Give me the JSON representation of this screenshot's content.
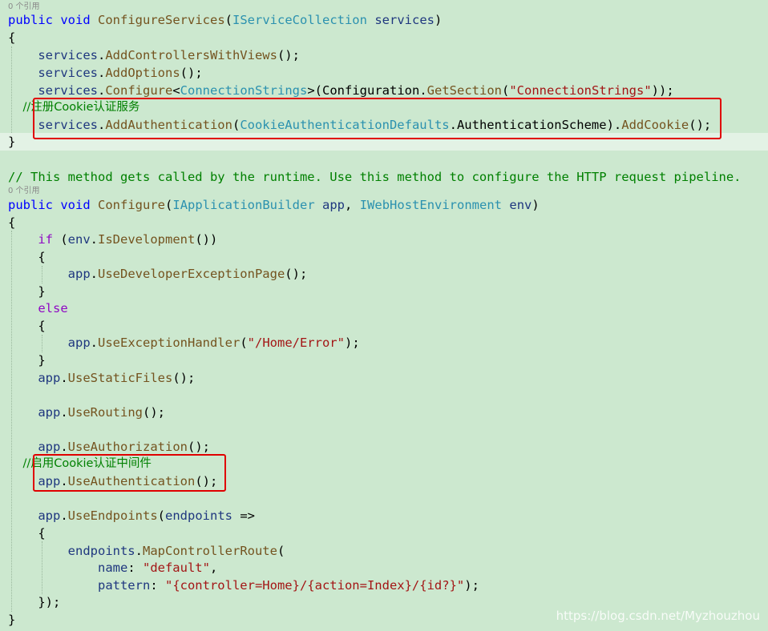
{
  "codelens": {
    "configure_services_refs": "0 个引用",
    "configure_refs": "0 个引用"
  },
  "code": {
    "l1": {
      "kw1": "public",
      "kw2": "void",
      "method": "ConfigureServices",
      "p1": "(",
      "type": "IServiceCollection",
      "param": "services",
      "p2": ")"
    },
    "l2": "{",
    "l3": {
      "obj": "services",
      "dot": ".",
      "method": "AddControllersWithViews",
      "rest": "();"
    },
    "l4": {
      "obj": "services",
      "dot": ".",
      "method": "AddOptions",
      "rest": "();"
    },
    "l5": {
      "obj": "services",
      "dot": ".",
      "method": "Configure",
      "lt": "<",
      "type": "ConnectionStrings",
      "gt": ">",
      "p1": "(",
      "cfg": "Configuration",
      "dot2": ".",
      "method2": "GetSection",
      "p2": "(",
      "str": "\"ConnectionStrings\"",
      "end": "));"
    },
    "l6": "//注册Cookie认证服务",
    "l7": {
      "obj": "services",
      "dot": ".",
      "method": "AddAuthentication",
      "p1": "(",
      "type": "CookieAuthenticationDefaults",
      "dot2": ".",
      "prop": "AuthenticationScheme",
      "p2": ").",
      "method2": "AddCookie",
      "end": "();"
    },
    "l8": "}",
    "l9": "// This method gets called by the runtime. Use this method to configure the HTTP request pipeline.",
    "l10": {
      "kw1": "public",
      "kw2": "void",
      "method": "Configure",
      "p1": "(",
      "type1": "IApplicationBuilder",
      "param1": "app",
      "comma": ",",
      "type2": "IWebHostEnvironment",
      "param2": "env",
      "p2": ")"
    },
    "l11": "{",
    "l12": {
      "kw": "if",
      "p1": " (",
      "obj": "env",
      "dot": ".",
      "method": "IsDevelopment",
      "end": "())"
    },
    "l13": "{",
    "l14": {
      "obj": "app",
      "dot": ".",
      "method": "UseDeveloperExceptionPage",
      "end": "();"
    },
    "l15": "}",
    "l16": "else",
    "l17": "{",
    "l18": {
      "obj": "app",
      "dot": ".",
      "method": "UseExceptionHandler",
      "p1": "(",
      "str": "\"/Home/Error\"",
      "end": ");"
    },
    "l19": "}",
    "l20": {
      "obj": "app",
      "dot": ".",
      "method": "UseStaticFiles",
      "end": "();"
    },
    "l21": {
      "obj": "app",
      "dot": ".",
      "method": "UseRouting",
      "end": "();"
    },
    "l22": {
      "obj": "app",
      "dot": ".",
      "method": "UseAuthorization",
      "end": "();"
    },
    "l23": "//启用Cookie认证中间件",
    "l24": {
      "obj": "app",
      "dot": ".",
      "method": "UseAuthentication",
      "end": "();"
    },
    "l25": {
      "obj": "app",
      "dot": ".",
      "method": "UseEndpoints",
      "p1": "(",
      "param": "endpoints",
      "arrow": " =>"
    },
    "l26": "{",
    "l27": {
      "obj": "endpoints",
      "dot": ".",
      "method": "MapControllerRoute",
      "end": "("
    },
    "l28": {
      "name": "name",
      "colon": ": ",
      "str": "\"default\"",
      "end": ","
    },
    "l29": {
      "name": "pattern",
      "colon": ": ",
      "str": "\"{controller=Home}/{action=Index}/{id?}\"",
      "end": ");"
    },
    "l30": "});",
    "l31": "}"
  },
  "watermark": "https://blog.csdn.net/Myzhouzhou",
  "colors": {
    "background": "#cce8cf",
    "keyword": "#0000ff",
    "type": "#2b91af",
    "method": "#74531f",
    "string": "#a31515",
    "comment": "#008000",
    "variable": "#1f377f",
    "highlight_box": "#e00000"
  }
}
